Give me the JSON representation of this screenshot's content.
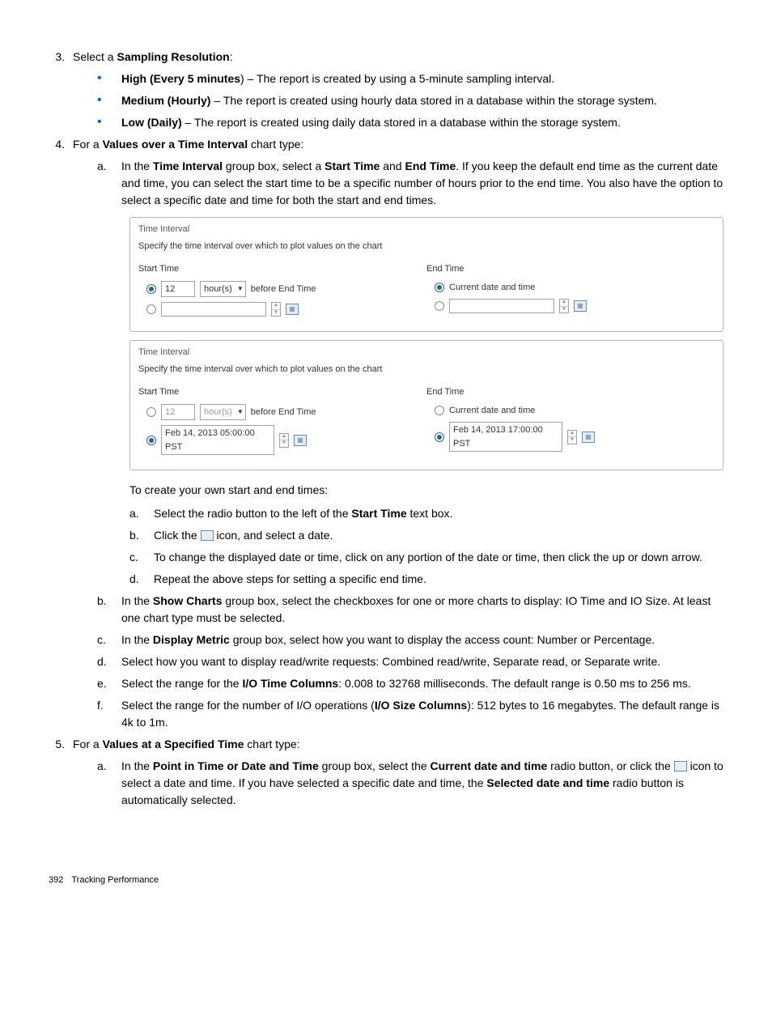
{
  "step3": {
    "num": "3.",
    "text_prefix": "Select a ",
    "text_bold": "Sampling Resolution",
    "text_suffix": ":",
    "bullets": [
      {
        "bold": "High (Every 5 minutes",
        "bold_close": ")",
        "rest": " – The report is created by using a 5-minute sampling interval."
      },
      {
        "bold": "Medium (Hourly)",
        "bold_close": "",
        "rest": " – The report is created using hourly data stored in a database within the storage system."
      },
      {
        "bold": "Low (Daily)",
        "bold_close": "",
        "rest": " – The report is created using daily data stored in a database within the storage system."
      }
    ]
  },
  "step4": {
    "num": "4.",
    "text_prefix": "For a ",
    "text_bold": "Values over a Time Interval",
    "text_suffix": " chart type:",
    "a": {
      "lbl": "a.",
      "parts": [
        "In the ",
        "Time Interval",
        " group box, select a ",
        "Start Time",
        " and ",
        "End Time",
        ". If you keep the default end time as the current date and time, you can select the start time to be a specific number of hours prior to the end time. You also have the option to select a specific date and time for both the start and end times."
      ]
    },
    "panel1": {
      "title": "Time Interval",
      "desc": "Specify the time interval over which to plot values on the chart",
      "start_label": "Start Time",
      "end_label": "End Time",
      "hours_value": "12",
      "unit": "hour(s)",
      "before_text": "before End Time",
      "current_text": "Current date and time"
    },
    "panel2": {
      "title": "Time Interval",
      "desc": "Specify the time interval over which to plot values on the chart",
      "start_label": "Start Time",
      "end_label": "End Time",
      "hours_value": "12",
      "unit": "hour(s)",
      "before_text": "before End Time",
      "current_text": "Current date and time",
      "start_date": "Feb 14, 2013 05:00:00 PST",
      "end_date": "Feb 14, 2013 17:00:00 PST"
    },
    "intro": "To create your own start and end times:",
    "nest": {
      "a": {
        "lbl": "a.",
        "pre": "Select the radio button to the left of the ",
        "b": "Start Time",
        "post": " text box."
      },
      "b": {
        "lbl": "b.",
        "pre": "Click the ",
        "post": " icon, and select a date."
      },
      "c": {
        "lbl": "c.",
        "text": "To change the displayed date or time, click on any portion of the date or time, then click the up or down arrow."
      },
      "d": {
        "lbl": "d.",
        "text": "Repeat the above steps for setting a specific end time."
      }
    },
    "b": {
      "lbl": "b.",
      "pre": "In the ",
      "bold": "Show Charts",
      "post": " group box, select the checkboxes for one or more charts to display: IO Time and IO Size. At least one chart type must be selected."
    },
    "c": {
      "lbl": "c.",
      "pre": "In the ",
      "bold": "Display Metric",
      "post": " group box, select how you want to display the access count: Number or Percentage."
    },
    "d": {
      "lbl": "d.",
      "text": "Select how you want to display read/write requests: Combined read/write, Separate read, or Separate write."
    },
    "e": {
      "lbl": "e.",
      "pre": "Select the range for the ",
      "bold": "I/O Time Columns",
      "post": ": 0.008 to 32768 milliseconds. The default range is 0.50 ms to 256 ms."
    },
    "f": {
      "lbl": "f.",
      "pre": "Select the range for the number of I/O operations (",
      "bold": "I/O Size Columns",
      "post": "): 512 bytes to 16 megabytes. The default range is 4k to 1m."
    }
  },
  "step5": {
    "num": "5.",
    "text_prefix": "For a ",
    "text_bold": "Values at a Specified Time",
    "text_suffix": " chart type:",
    "a": {
      "lbl": "a.",
      "p1_pre": "In the ",
      "p1_b1": "Point in Time or Date and Time",
      "p1_mid": " group box, select the ",
      "p1_b2": "Current date and time",
      "p1_post": " radio",
      "p2_pre": "button, or click the ",
      "p2_mid": " icon to select a date and time. If you have selected a specific date and time, the ",
      "p2_bold": "Selected date and time",
      "p2_post": " radio button is automatically selected."
    }
  },
  "footer": {
    "page": "392",
    "title": "Tracking Performance"
  }
}
